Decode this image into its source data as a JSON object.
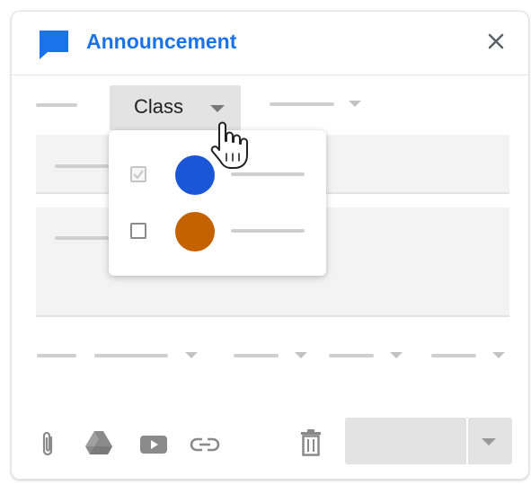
{
  "dialog": {
    "title": "Announcement",
    "icon": "announcement-icon",
    "accent_color": "#1a73e8"
  },
  "toolbar": {
    "class_button_label": "Class"
  },
  "class_dropdown": {
    "items": [
      {
        "checked": true,
        "color": "#1b56d6"
      },
      {
        "checked": false,
        "color": "#c46200"
      }
    ]
  },
  "bottom_icons": [
    "attach-icon",
    "drive-icon",
    "youtube-icon",
    "link-icon"
  ],
  "colors": {
    "placeholder": "#cfcfcf",
    "button_bg": "#e3e3e3"
  }
}
